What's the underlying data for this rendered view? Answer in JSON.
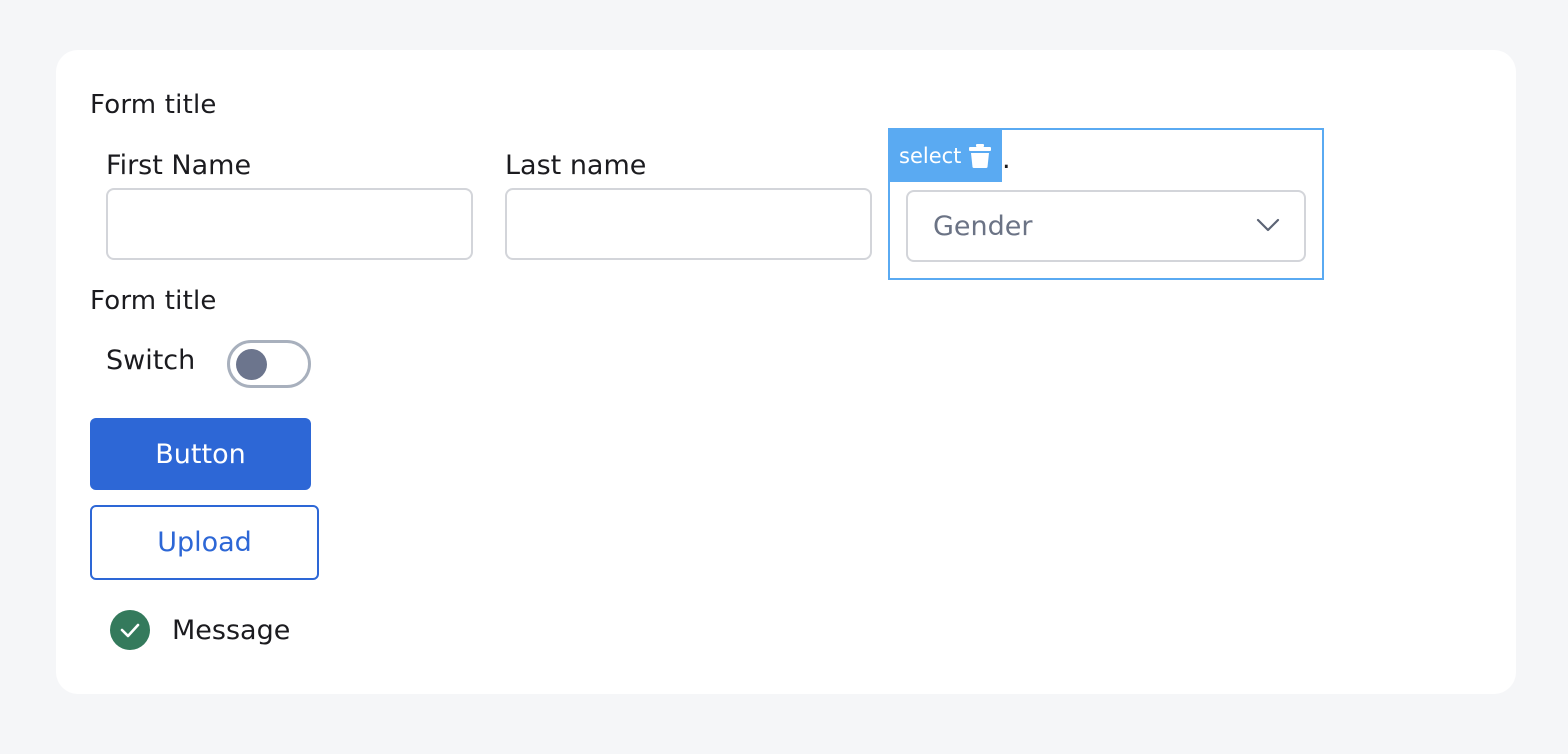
{
  "form": {
    "section1_title": "Form title",
    "first_name": {
      "label": "First Name",
      "value": ""
    },
    "last_name": {
      "label": "Last name",
      "value": ""
    },
    "select_field": {
      "tag_label": "select",
      "label_visible_tail": ".",
      "placeholder": "Gender"
    },
    "section2_title": "Form title",
    "switch": {
      "label": "Switch",
      "on": false
    },
    "button_label": "Button",
    "upload_label": "Upload",
    "message": {
      "text": "Message",
      "status": "success"
    }
  },
  "colors": {
    "page_bg": "#f5f6f8",
    "card_bg": "#ffffff",
    "primary": "#2d67d6",
    "selection": "#5aaaf2",
    "success": "#347a5c",
    "input_border": "#d3d5da"
  },
  "icons": {
    "delete": "trash-icon",
    "dropdown": "chevron-down-icon",
    "message": "check-circle-icon"
  }
}
